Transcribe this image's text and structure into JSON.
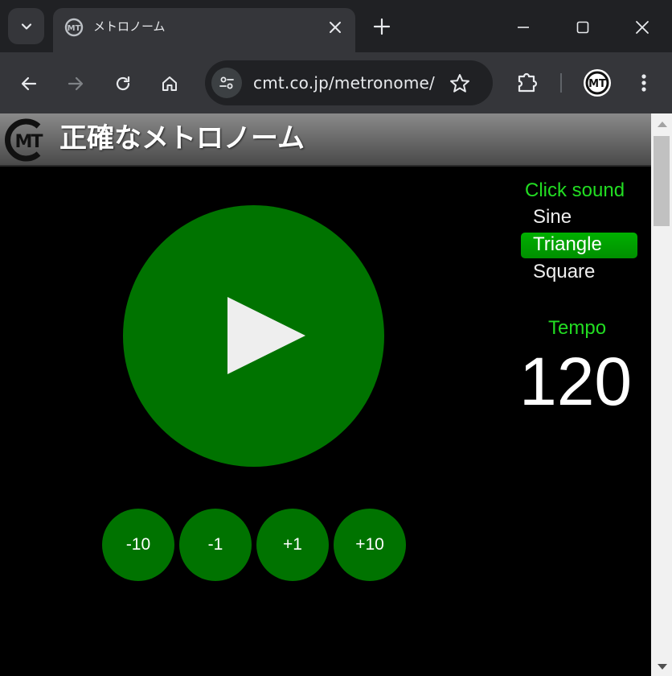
{
  "browser": {
    "tab_title": "メトロノーム",
    "url": "cmt.co.jp/metronome/",
    "colors": {
      "chrome_dark": "#202124",
      "chrome_toolbar": "#35363a"
    }
  },
  "page": {
    "title": "正確なメトロノーム",
    "logo_text": "MT",
    "play_label": "play-icon",
    "steps": [
      {
        "label": "-10"
      },
      {
        "label": "-1"
      },
      {
        "label": "+1"
      },
      {
        "label": "+10"
      }
    ],
    "click_sound": {
      "heading": "Click sound",
      "options": [
        "Sine",
        "Triangle",
        "Square"
      ],
      "selected": "Triangle"
    },
    "tempo": {
      "heading": "Tempo",
      "value": "120"
    },
    "colors": {
      "accent_green": "#007300",
      "heading_green": "#22dd22",
      "selected_green": "#00a000"
    }
  }
}
